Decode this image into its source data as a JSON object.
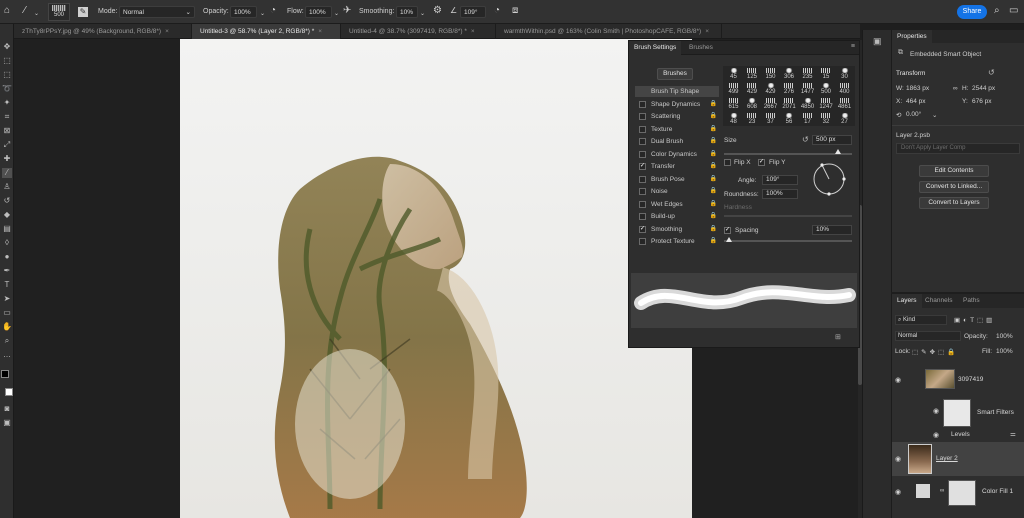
{
  "options_bar": {
    "brush_size": "500",
    "mode_label": "Mode:",
    "mode_value": "Normal",
    "opacity_label": "Opacity:",
    "opacity_value": "100%",
    "flow_label": "Flow:",
    "flow_value": "100%",
    "smoothing_label": "Smoothing:",
    "smoothing_value": "10%",
    "angle_value": "109°",
    "share_label": "Share"
  },
  "tabs": [
    {
      "label": "zThTy8rPPsY.jpg @ 49% (Background, RGB/8*)",
      "close": "×"
    },
    {
      "label": "Untitled-3 @ 58.7% (Layer 2, RGB/8*) *",
      "close": "×"
    },
    {
      "label": "Untitled-4 @ 38.7% (3097419, RGB/8*) *",
      "close": "×"
    },
    {
      "label": "warmthWithin.psd @ 163% (Colin Smith | PhotoshopCAFE, RGB/8*)",
      "close": "×"
    }
  ],
  "brush_settings": {
    "tab_brush_settings": "Brush Settings",
    "tab_brushes": "Brushes",
    "brushes_button": "Brushes",
    "options": [
      {
        "label": "Brush Tip Shape",
        "checked": false,
        "selected": true
      },
      {
        "label": "Shape Dynamics",
        "checked": false
      },
      {
        "label": "Scattering",
        "checked": false
      },
      {
        "label": "Texture",
        "checked": false
      },
      {
        "label": "Dual Brush",
        "checked": false
      },
      {
        "label": "Color Dynamics",
        "checked": false
      },
      {
        "label": "Transfer",
        "checked": true
      },
      {
        "label": "Brush Pose",
        "checked": false
      },
      {
        "label": "Noise",
        "checked": false
      },
      {
        "label": "Wet Edges",
        "checked": false
      },
      {
        "label": "Build-up",
        "checked": false
      },
      {
        "label": "Smoothing",
        "checked": true
      },
      {
        "label": "Protect Texture",
        "checked": false
      }
    ],
    "tip_sizes": [
      "45",
      "125",
      "150",
      "306",
      "235",
      "15",
      "30",
      "499",
      "429",
      "429",
      "276",
      "1477",
      "500",
      "400",
      "615",
      "608",
      "2667",
      "2071",
      "4850",
      "1247",
      "4861",
      "48",
      "23",
      "37",
      "56",
      "17",
      "32",
      "27"
    ],
    "size_label": "Size",
    "size_value": "500 px",
    "flip_x": "Flip X",
    "flip_y": "Flip Y",
    "angle_label": "Angle:",
    "angle_value": "109°",
    "roundness_label": "Roundness:",
    "roundness_value": "100%",
    "hardness_label": "Hardness",
    "spacing_label": "Spacing",
    "spacing_value": "10%"
  },
  "properties": {
    "tab": "Properties",
    "type": "Embedded Smart Object",
    "transform": "Transform",
    "w_label": "W:",
    "w_value": "1863 px",
    "h_label": "H:",
    "h_value": "2544 px",
    "x_label": "X:",
    "x_value": "464 px",
    "y_label": "Y:",
    "y_value": "676 px",
    "angle_value": "0.00°",
    "file": "Layer 2.psb",
    "layer_comp": "Don't Apply Layer Comp",
    "edit_contents": "Edit Contents",
    "convert_linked": "Convert to Linked...",
    "convert_layers": "Convert to Layers"
  },
  "layers": {
    "tabs": [
      "Layers",
      "Channels",
      "Paths"
    ],
    "kind": "Kind",
    "blend": "Normal",
    "opacity_label": "Opacity:",
    "opacity_value": "100%",
    "lock_label": "Lock:",
    "fill_label": "Fill:",
    "fill_value": "100%",
    "rows": [
      {
        "name": "3097419"
      },
      {
        "name": "Smart Filters"
      },
      {
        "name": "Levels"
      },
      {
        "name": "Layer 2"
      },
      {
        "name": "Color Fill 1"
      }
    ]
  },
  "colors": {
    "accent": "#1473e6",
    "panel": "#2e2e2e"
  }
}
